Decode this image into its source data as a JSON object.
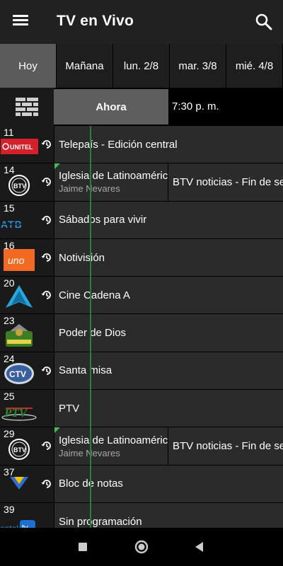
{
  "app": {
    "title": "TV en Vivo"
  },
  "days": [
    "Hoy",
    "Mañana",
    "lun. 2/8",
    "mar. 3/8",
    "mié. 4/8"
  ],
  "active_day": "Hoy",
  "timebar": {
    "now_label": "Ahora",
    "time": "7:30 p. m."
  },
  "channels": [
    {
      "number": "11",
      "logo_text": "UNITEL",
      "programs": [
        "Telepaís - Edición central"
      ]
    },
    {
      "number": "14",
      "logo_text": "BTV",
      "programs": [
        "Iglesia de Latinoamérica",
        "BTV noticias - Fin de semana"
      ],
      "subtitle": "Jaime Nevares"
    },
    {
      "number": "15",
      "logo_text": "ATB",
      "programs": [
        "Sábados para vivir"
      ]
    },
    {
      "number": "16",
      "logo_text": "uno",
      "programs": [
        "Notivisión"
      ]
    },
    {
      "number": "20",
      "logo_text": "A",
      "programs": [
        "Cine Cadena A"
      ]
    },
    {
      "number": "23",
      "logo_text": "Poder de Dios",
      "programs": [
        "Poder de Dios"
      ]
    },
    {
      "number": "24",
      "logo_text": "CTV",
      "programs": [
        "Santa misa"
      ]
    },
    {
      "number": "25",
      "logo_text": "PTV",
      "programs": [
        "PTV"
      ]
    },
    {
      "number": "29",
      "logo_text": "BTV",
      "programs": [
        "Iglesia de Latinoamérica",
        "BTV noticias - Fin de semana"
      ],
      "subtitle": "Jaime Nevares"
    },
    {
      "number": "37",
      "logo_text": "Nuevo Tiempo",
      "programs": [
        "Bloc de notas"
      ]
    },
    {
      "number": "39",
      "logo_text": "entel tv",
      "programs": [
        "Sin programación"
      ]
    }
  ],
  "colors": {
    "accent_green": "#3fbf5a",
    "now_line": "#2e7d32",
    "active_tab": "#5b5b5b"
  },
  "icons": {
    "menu": "hamburger-icon",
    "search": "search-icon",
    "grid": "brick-grid-icon",
    "catchup": "replay-clock-icon"
  }
}
